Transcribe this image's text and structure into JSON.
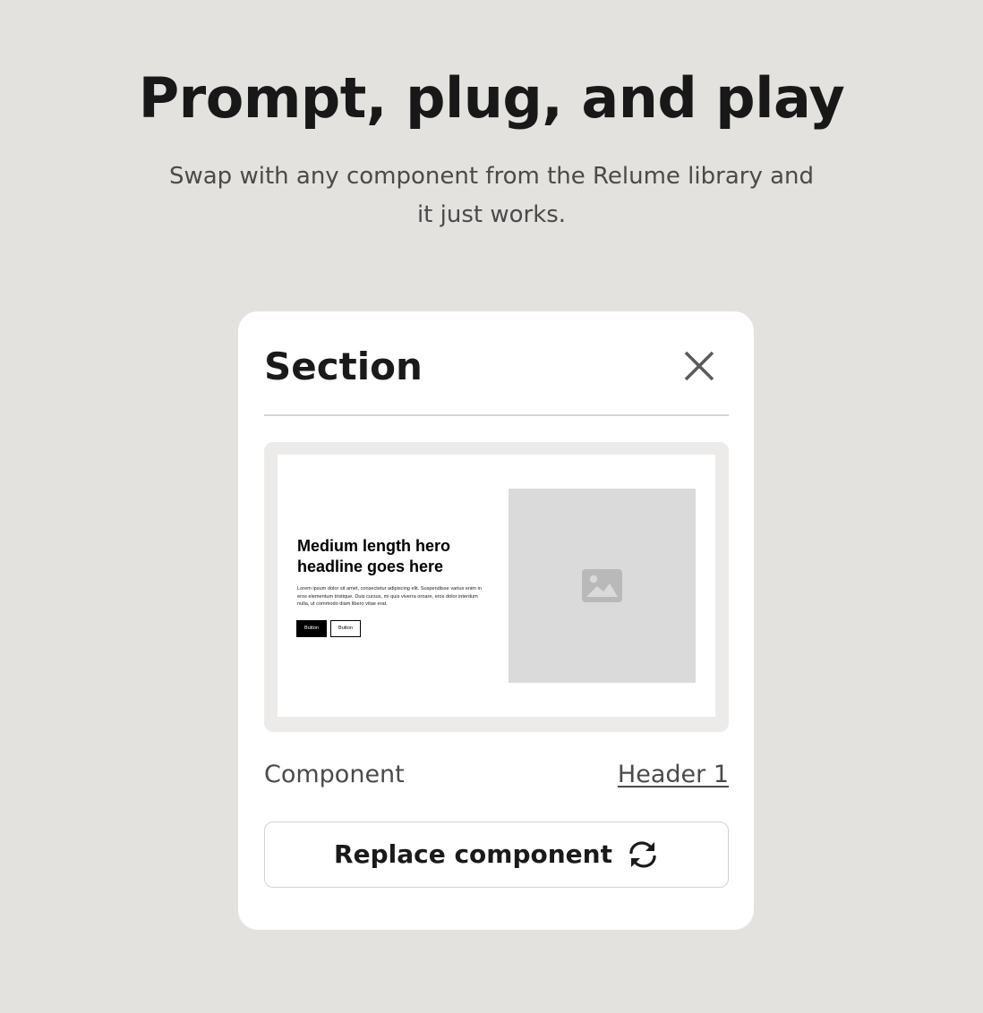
{
  "hero": {
    "title": "Prompt, plug, and play",
    "subtitle": "Swap with any component from the Relume library and it just works."
  },
  "panel": {
    "title": "Section",
    "close_icon": "close-icon",
    "preview": {
      "headline": "Medium length hero headline goes here",
      "body": "Lorem ipsum dolor sit amet, consectetur adipiscing elit. Suspendisse varius enim in eros elementum tristique. Duis cursus, mi quis viverra ornare, eros dolor interdum nulla, ut commodo diam libero vitae erat.",
      "primary_button": "Button",
      "secondary_button": "Button",
      "image_icon": "image-placeholder-icon"
    },
    "component_label": "Component",
    "component_value": "Header 1",
    "replace_button_label": "Replace component",
    "replace_icon": "refresh-icon"
  },
  "colors": {
    "page_background": "#e3e2df",
    "card_background": "#ffffff",
    "text_primary": "#1a1a1a",
    "text_secondary": "#4a4a4a"
  }
}
